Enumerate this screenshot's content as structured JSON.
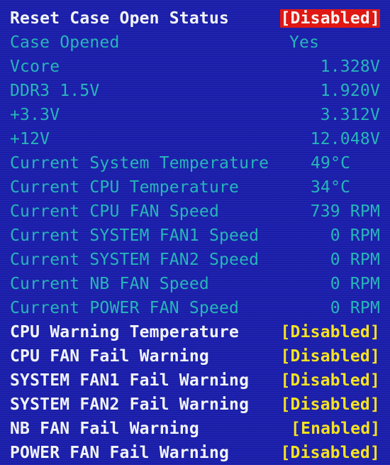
{
  "reset_case": {
    "label": "Reset Case Open Status",
    "value": "Disabled"
  },
  "case_opened": {
    "label": "Case Opened",
    "value": "Yes"
  },
  "voltages": [
    {
      "label": "Vcore",
      "value": "1.328V"
    },
    {
      "label": "DDR3 1.5V",
      "value": "1.920V"
    },
    {
      "label": "+3.3V",
      "value": "3.312V"
    },
    {
      "label": "+12V",
      "value": "12.048V"
    }
  ],
  "monitors": [
    {
      "label": "Current System Temperature",
      "value": "49°C"
    },
    {
      "label": "Current CPU Temperature",
      "value": "34°C"
    },
    {
      "label": "Current CPU FAN Speed",
      "value": "739 RPM"
    },
    {
      "label": "Current SYSTEM FAN1 Speed",
      "value": "0 RPM"
    },
    {
      "label": "Current SYSTEM FAN2 Speed",
      "value": "0 RPM"
    },
    {
      "label": "Current NB FAN Speed",
      "value": "0 RPM"
    },
    {
      "label": "Current POWER FAN Speed",
      "value": "0 RPM"
    }
  ],
  "warnings": [
    {
      "label": "CPU Warning Temperature",
      "value": "Disabled"
    },
    {
      "label": "CPU FAN Fail Warning",
      "value": "Disabled"
    },
    {
      "label": "SYSTEM FAN1 Fail Warning",
      "value": "Disabled"
    },
    {
      "label": "SYSTEM FAN2 Fail Warning",
      "value": "Disabled"
    },
    {
      "label": "NB FAN Fail Warning",
      "value": "Enabled"
    },
    {
      "label": "POWER FAN Fail Warning",
      "value": "Disabled"
    }
  ],
  "colors": {
    "background": "#1b1fb0",
    "label_white": "#f2f4f6",
    "readout_cyan": "#27b6b8",
    "option_yellow": "#f5e31f",
    "highlight_red": "#e01712"
  }
}
